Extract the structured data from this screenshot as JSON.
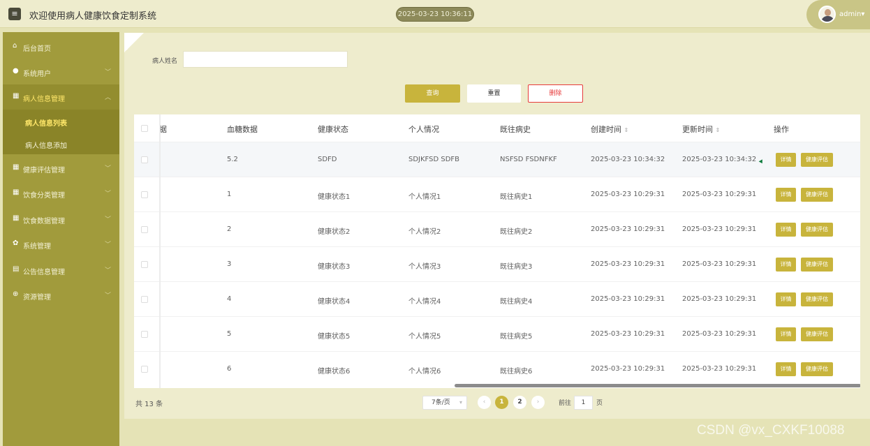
{
  "header": {
    "menu_icon": "hamburger-icon",
    "title": "欢迎使用病人健康饮食定制系统",
    "datetime": "2025-03-23 10:36:11",
    "user": "admin",
    "user_caret": "▾"
  },
  "sidebar": {
    "items": [
      {
        "label": "后台首页",
        "icon": "home-icon",
        "glyph": "⌂",
        "chevron": ""
      },
      {
        "label": "系统用户",
        "icon": "user-icon",
        "glyph": "●",
        "chevron": "﹀"
      },
      {
        "label": "病人信息管理",
        "icon": "grid-icon",
        "glyph": "▦",
        "chevron": "︿"
      },
      {
        "label": "健康评估管理",
        "icon": "grid-icon",
        "glyph": "▦",
        "chevron": "﹀"
      },
      {
        "label": "饮食分类管理",
        "icon": "grid-icon",
        "glyph": "▦",
        "chevron": "﹀"
      },
      {
        "label": "饮食数据管理",
        "icon": "grid-icon",
        "glyph": "▦",
        "chevron": "﹀"
      },
      {
        "label": "系统管理",
        "icon": "gear-icon",
        "glyph": "✿",
        "chevron": "﹀"
      },
      {
        "label": "公告信息管理",
        "icon": "document-icon",
        "glyph": "▤",
        "chevron": "﹀"
      },
      {
        "label": "资源管理",
        "icon": "plus-circle-icon",
        "glyph": "⊕",
        "chevron": "﹀"
      }
    ],
    "subitems": [
      {
        "label": "病人信息列表",
        "selected": true
      },
      {
        "label": "病人信息添加",
        "selected": false
      }
    ]
  },
  "search": {
    "label": "病人姓名",
    "value": "",
    "placeholder": ""
  },
  "buttons": {
    "query": "查询",
    "reset": "重置",
    "delete": "删除"
  },
  "table": {
    "columns": [
      "据",
      "血糖数据",
      "健康状态",
      "个人情况",
      "既往病史",
      "创建时间",
      "更新时间",
      "操作"
    ],
    "sort_glyph": "⇕",
    "rows": [
      {
        "blood_sugar": "5.2",
        "health": "SDFD",
        "personal": "SDJKFSD SDFB",
        "history": "NSFSD FSDNFKF",
        "created": "2025-03-23 10:34:32",
        "updated": "2025-03-23 10:34:32"
      },
      {
        "blood_sugar": "1",
        "health": "健康状态1",
        "personal": "个人情况1",
        "history": "既往病史1",
        "created": "2025-03-23 10:29:31",
        "updated": "2025-03-23 10:29:31"
      },
      {
        "blood_sugar": "2",
        "health": "健康状态2",
        "personal": "个人情况2",
        "history": "既往病史2",
        "created": "2025-03-23 10:29:31",
        "updated": "2025-03-23 10:29:31"
      },
      {
        "blood_sugar": "3",
        "health": "健康状态3",
        "personal": "个人情况3",
        "history": "既往病史3",
        "created": "2025-03-23 10:29:31",
        "updated": "2025-03-23 10:29:31"
      },
      {
        "blood_sugar": "4",
        "health": "健康状态4",
        "personal": "个人情况4",
        "history": "既往病史4",
        "created": "2025-03-23 10:29:31",
        "updated": "2025-03-23 10:29:31"
      },
      {
        "blood_sugar": "5",
        "health": "健康状态5",
        "personal": "个人情况5",
        "history": "既往病史5",
        "created": "2025-03-23 10:29:31",
        "updated": "2025-03-23 10:29:31"
      },
      {
        "blood_sugar": "6",
        "health": "健康状态6",
        "personal": "个人情况6",
        "history": "既往病史6",
        "created": "2025-03-23 10:29:31",
        "updated": "2025-03-23 10:29:31"
      }
    ],
    "action_detail": "详情",
    "action_assess": "健康评估"
  },
  "pagination": {
    "total": "共 13 条",
    "page_size": "7条/页",
    "pages": [
      "1",
      "2"
    ],
    "current": "1",
    "prev": "‹",
    "next": "›",
    "goto_prefix": "前往",
    "goto_value": "1",
    "goto_suffix": "页"
  },
  "watermark": "CSDN @vx_CXKF10088",
  "colors": {
    "accent": "#c8b43c",
    "sidebar": "#a19b3c",
    "danger": "#e63a3a"
  }
}
